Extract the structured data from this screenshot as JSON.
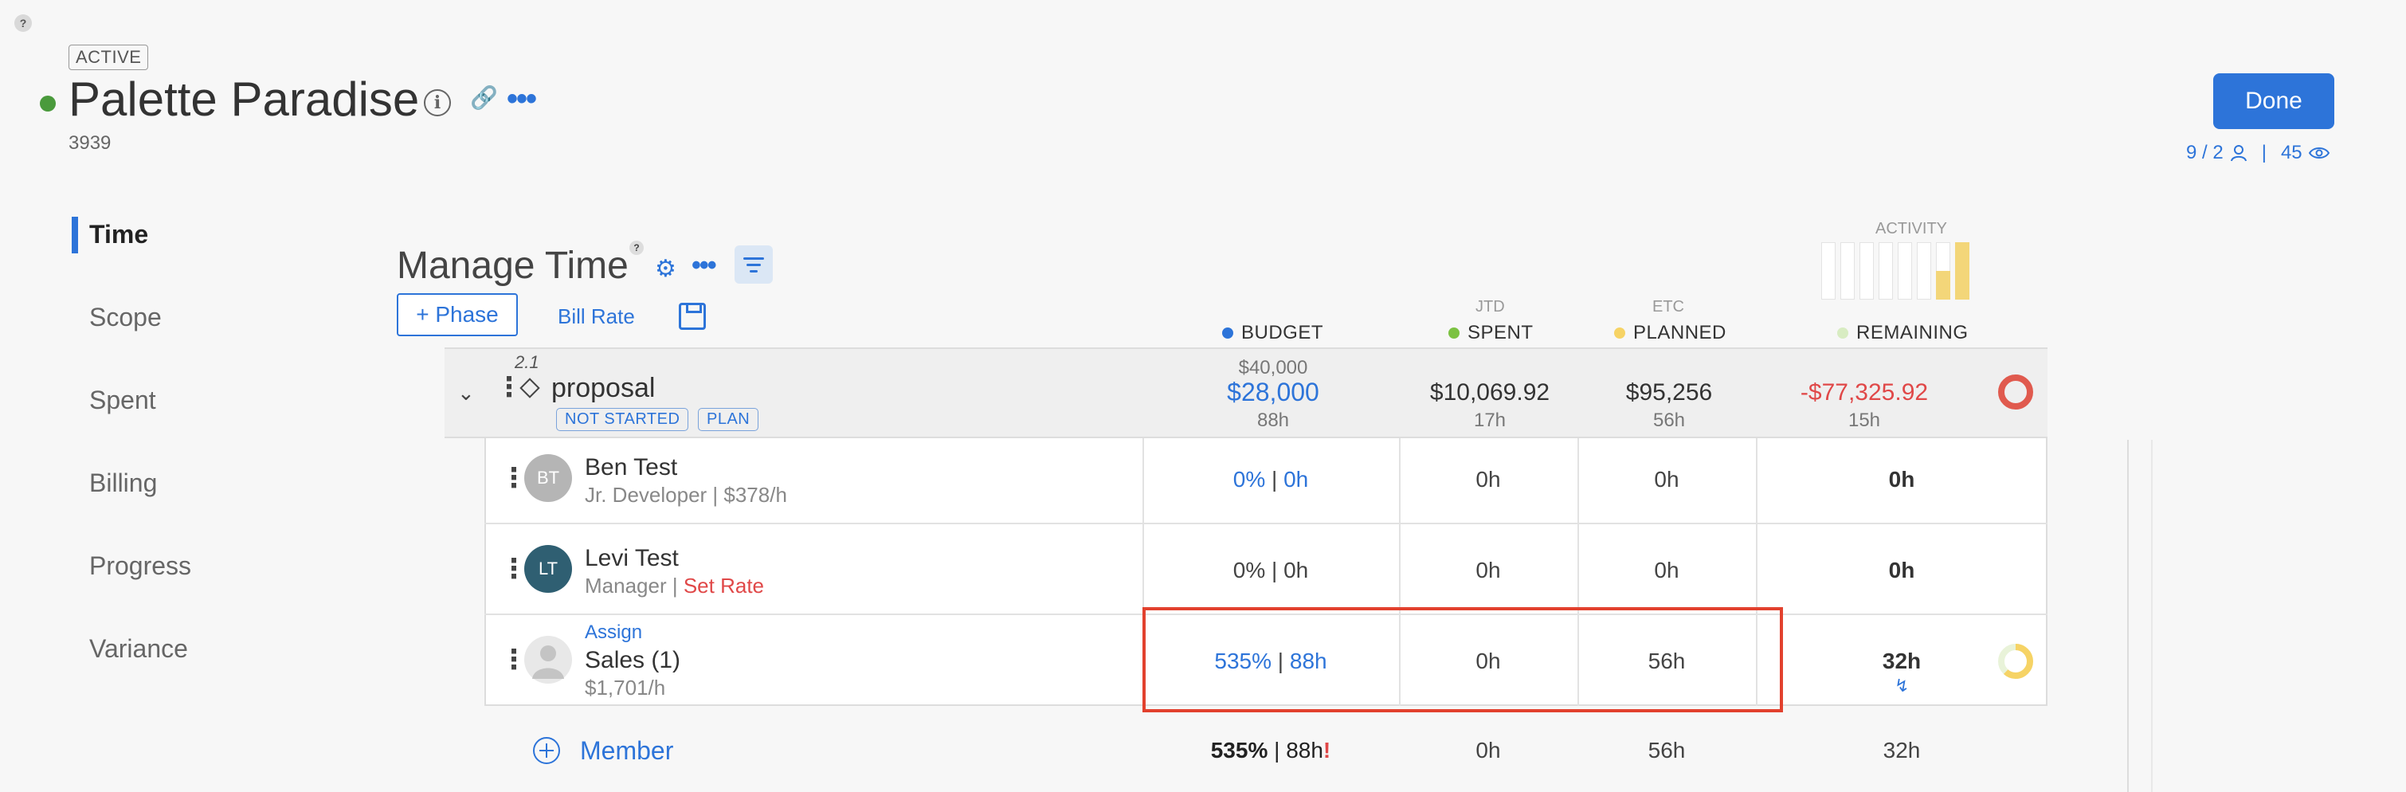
{
  "help_label": "?",
  "project": {
    "status": "ACTIVE",
    "title": "Palette Paradise",
    "number": "3939",
    "status_color": "#4a9a3c"
  },
  "header": {
    "done_label": "Done",
    "members_stat": "9 / 2",
    "separator": "|",
    "views_stat": "45"
  },
  "nav": {
    "items": [
      "Time",
      "Scope",
      "Spent",
      "Billing",
      "Progress",
      "Variance"
    ],
    "active": "Time"
  },
  "manage": {
    "title": "Manage Time",
    "help": "?",
    "add_phase_label": "+ Phase",
    "bill_rate_label": "Bill Rate"
  },
  "activity": {
    "label": "ACTIVITY",
    "levels": [
      0,
      0,
      0,
      0,
      0,
      0,
      0.5,
      1
    ]
  },
  "columns": {
    "budget": {
      "label": "BUDGET",
      "color": "#2d74d9"
    },
    "spent": {
      "sub": "JTD",
      "label": "SPENT",
      "color": "#7cc242"
    },
    "planned": {
      "sub": "ETC",
      "label": "PLANNED",
      "color": "#f6d365"
    },
    "remaining": {
      "label": "REMAINING",
      "color": "#d8ecc2"
    }
  },
  "phase": {
    "number": "2.1",
    "name": "proposal",
    "tags": [
      "NOT STARTED",
      "PLAN"
    ],
    "budget_total": "$40,000",
    "budget_amount": "$28,000",
    "budget_hours": "88h",
    "spent_amount": "$10,069.92",
    "spent_hours": "17h",
    "planned_amount": "$95,256",
    "planned_hours": "56h",
    "remaining_amount": "-$77,325.92",
    "remaining_hours": "15h"
  },
  "members": [
    {
      "initials": "BT",
      "name": "Ben Test",
      "role": "Jr. Developer",
      "rate": "$378/h",
      "budget_pct": "0%",
      "budget_hours": "0h",
      "spent": "0h",
      "planned": "0h",
      "remaining": "0h",
      "avatar_color": "#b5b5b5"
    },
    {
      "initials": "LT",
      "name": "Levi Test",
      "role": "Manager",
      "rate": "Set Rate",
      "budget_pct": "0%",
      "budget_hours": "0h",
      "spent": "0h",
      "planned": "0h",
      "remaining": "0h",
      "avatar_color": "#2f5f72"
    },
    {
      "assign": "Assign",
      "name": "Sales (1)",
      "rate": "$1,701/h",
      "budget_pct": "535%",
      "budget_hours": "88h",
      "spent": "0h",
      "planned": "56h",
      "remaining": "32h"
    }
  ],
  "totals": {
    "member_label": "Member",
    "budget_pct": "535%",
    "budget_hours": "88h",
    "warning": "!",
    "spent": "0h",
    "planned": "56h",
    "remaining": "32h"
  }
}
